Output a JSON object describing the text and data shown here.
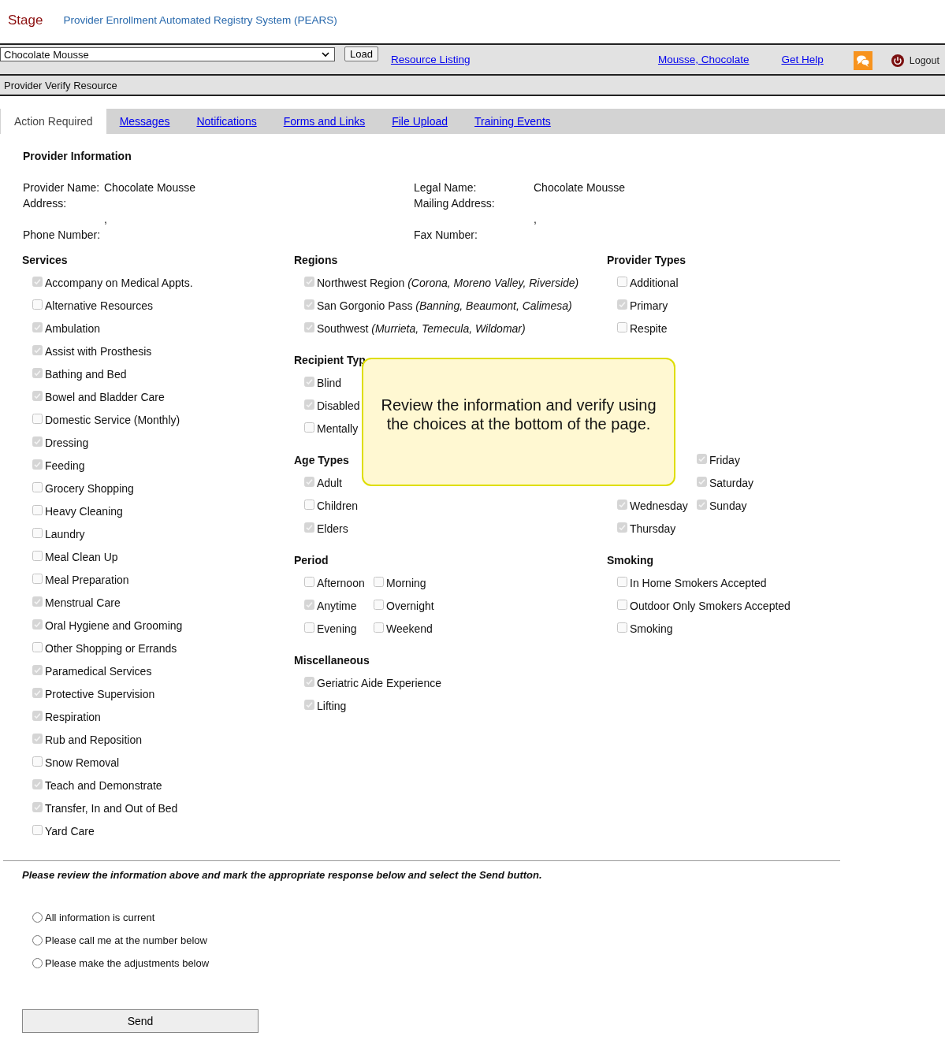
{
  "header": {
    "environment": "Stage",
    "system_title": "Provider Enrollment Automated Registry System (PEARS)"
  },
  "toolbar": {
    "provider_select": "Chocolate Mousse",
    "load_button": "Load",
    "resource_link": "Resource Listing",
    "user_link": "Mousse, Chocolate",
    "help_link": "Get Help",
    "logout": "Logout"
  },
  "page_title": "Provider Verify Resource",
  "tabs": [
    {
      "label": "Action Required",
      "selected": true
    },
    {
      "label": "Messages",
      "selected": false
    },
    {
      "label": "Notifications",
      "selected": false
    },
    {
      "label": "Forms and Links",
      "selected": false
    },
    {
      "label": "File Upload",
      "selected": false
    },
    {
      "label": "Training Events",
      "selected": false
    }
  ],
  "provider_information": {
    "title": "Provider Information",
    "left": [
      {
        "label": "Provider Name:",
        "value": "Chocolate Mousse"
      },
      {
        "label": "Address:"
      },
      {
        "value": ","
      },
      {
        "label": "Phone Number:"
      }
    ],
    "right": [
      {
        "label": "Legal Name:",
        "value": "Chocolate Mousse"
      },
      {
        "label": "Mailing Address:"
      },
      {
        "value": ","
      },
      {
        "label": "Fax Number:"
      }
    ]
  },
  "services": {
    "title": "Services",
    "items": [
      {
        "label": "Accompany on Medical Appts.",
        "checked": true
      },
      {
        "label": "Alternative Resources",
        "checked": false
      },
      {
        "label": "Ambulation",
        "checked": true
      },
      {
        "label": "Assist with Prosthesis",
        "checked": true
      },
      {
        "label": "Bathing and Bed",
        "checked": true
      },
      {
        "label": "Bowel and Bladder Care",
        "checked": true
      },
      {
        "label": "Domestic Service (Monthly)",
        "checked": false
      },
      {
        "label": "Dressing",
        "checked": true
      },
      {
        "label": "Feeding",
        "checked": true
      },
      {
        "label": "Grocery Shopping",
        "checked": false
      },
      {
        "label": "Heavy Cleaning",
        "checked": false
      },
      {
        "label": "Laundry",
        "checked": false
      },
      {
        "label": "Meal Clean Up",
        "checked": false
      },
      {
        "label": "Meal Preparation",
        "checked": false
      },
      {
        "label": "Menstrual Care",
        "checked": true
      },
      {
        "label": "Oral Hygiene and Grooming",
        "checked": true
      },
      {
        "label": "Other Shopping or Errands",
        "checked": false
      },
      {
        "label": "Paramedical Services",
        "checked": true
      },
      {
        "label": "Protective Supervision",
        "checked": true
      },
      {
        "label": "Respiration",
        "checked": true
      },
      {
        "label": "Rub and Reposition",
        "checked": true
      },
      {
        "label": "Snow Removal",
        "checked": false
      },
      {
        "label": "Teach and Demonstrate",
        "checked": true
      },
      {
        "label": "Transfer, In and Out of Bed",
        "checked": true
      },
      {
        "label": "Yard Care",
        "checked": false
      }
    ]
  },
  "regions": {
    "title": "Regions",
    "items": [
      {
        "label": "Northwest Region *(Corona, Moreno Valley, Riverside)*",
        "checked": true
      },
      {
        "label": "San Gorgonio Pass *(Banning, Beaumont, Calimesa)*",
        "checked": true
      },
      {
        "label": "Southwest *(Murrieta, Temecula, Wildomar)*",
        "checked": true
      }
    ]
  },
  "recipient_types": {
    "title": "Recipient Typ",
    "items": [
      {
        "label": "Blind",
        "checked": true
      },
      {
        "label": "Disabled",
        "checked": true
      },
      {
        "label": "Mentally",
        "checked": false
      }
    ]
  },
  "age_types": {
    "title": "Age Types",
    "items": [
      {
        "label": "Adult",
        "checked": true
      },
      {
        "label": "Children",
        "checked": false
      },
      {
        "label": "Elders",
        "checked": true
      }
    ]
  },
  "period": {
    "title": "Period",
    "items": [
      {
        "label": "Afternoon",
        "checked": false
      },
      {
        "label": "Anytime",
        "checked": true
      },
      {
        "label": "Evening",
        "checked": false
      },
      {
        "label": "Morning",
        "checked": false
      },
      {
        "label": "Overnight",
        "checked": false
      },
      {
        "label": "Weekend",
        "checked": false
      }
    ]
  },
  "miscellaneous": {
    "title": "Miscellaneous",
    "items": [
      {
        "label": "Geriatric Aide Experience",
        "checked": true
      },
      {
        "label": "Lifting",
        "checked": true
      }
    ]
  },
  "provider_types": {
    "title": "Provider Types",
    "items": [
      {
        "label": "Additional",
        "checked": false
      },
      {
        "label": "Primary",
        "checked": true
      },
      {
        "label": "Respite",
        "checked": false
      }
    ]
  },
  "days": {
    "column_1": [
      {
        "label": "Wednesday",
        "checked": true
      },
      {
        "label": "Thursday",
        "checked": true
      }
    ],
    "column_2": [
      {
        "label": "Friday",
        "checked": true
      },
      {
        "label": "Saturday",
        "checked": true
      },
      {
        "label": "Sunday",
        "checked": true
      }
    ]
  },
  "smoking": {
    "title": "Smoking",
    "items": [
      {
        "label": "In Home Smokers Accepted",
        "checked": false
      },
      {
        "label": "Outdoor Only Smokers Accepted",
        "checked": false
      },
      {
        "label": "Smoking",
        "checked": false
      }
    ]
  },
  "callout": "Review the information and verify using the choices at the bottom of the page.",
  "verification": {
    "instruction": "Please review the information above and mark the appropriate response below and select the Send button.",
    "options": [
      {
        "label": "All information is current",
        "selected": false
      },
      {
        "label": "Please call me at the number below",
        "selected": false
      },
      {
        "label": "Please make the adjustments below",
        "selected": false
      }
    ],
    "send_button": "Send"
  }
}
